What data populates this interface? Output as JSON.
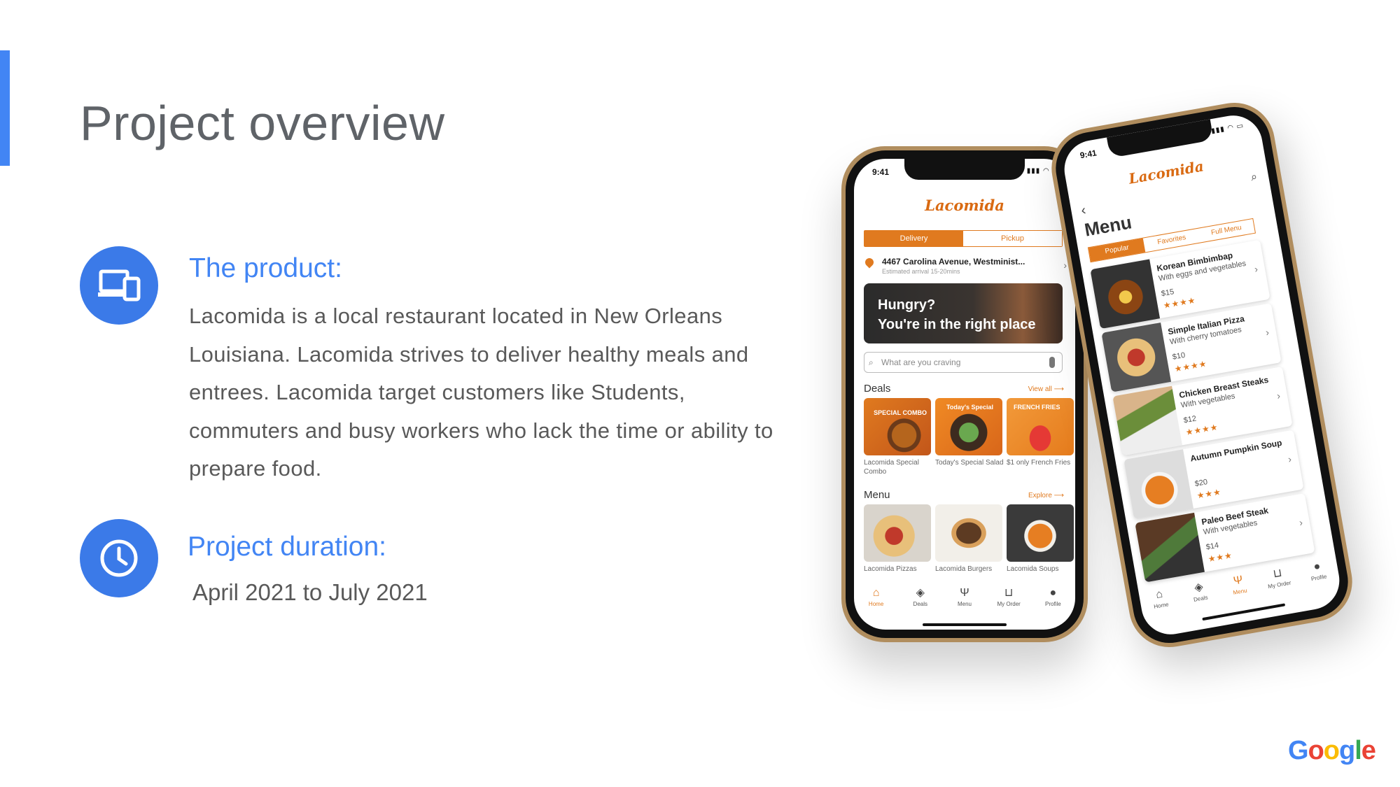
{
  "slide": {
    "title": "Project overview",
    "product_heading": "The product:",
    "product_description": "Lacomida is a local restaurant located in New Orleans Louisiana. Lacomida strives to deliver healthy meals and entrees. Lacomida target customers like Students, commuters and busy workers who lack the time or ability to prepare food.",
    "duration_heading": "Project duration:",
    "duration_value": "April 2021 to July 2021",
    "footer_logo": [
      "G",
      "o",
      "o",
      "g",
      "l",
      "e"
    ],
    "footer_logo_colors": [
      "#4285f4",
      "#ea4335",
      "#fbbc05",
      "#4285f4",
      "#34a853",
      "#ea4335"
    ],
    "accent_color": "#4285f4",
    "icons": {
      "product": "devices-icon",
      "duration": "clock-icon"
    }
  },
  "phone_home": {
    "time": "9:41",
    "logo": "Lacomida",
    "segments": [
      "Delivery",
      "Pickup"
    ],
    "address": "4467 Carolina Avenue, Westminist...",
    "arrival": "Estimated arrival 15-20mins",
    "hero_line1": "Hungry?",
    "hero_line2": "You're in the right place",
    "search_placeholder": "What are you craving",
    "deals_label": "Deals",
    "deals_link": "View all ⟶",
    "deals": [
      {
        "caption": "Lacomida  Special Combo",
        "badge": "SPECIAL COMBO"
      },
      {
        "caption": "Today's  Special Salad",
        "badge": "Today's Special"
      },
      {
        "caption": "$1 only French Fries",
        "badge": "FRENCH FRIES"
      }
    ],
    "menu_label": "Menu",
    "menu_link": "Explore ⟶",
    "menu": [
      {
        "caption": "Lacomida Pizzas"
      },
      {
        "caption": "Lacomida Burgers"
      },
      {
        "caption": "Lacomida Soups"
      }
    ],
    "tabs": [
      "Home",
      "Deals",
      "Menu",
      "My Order",
      "Profile"
    ]
  },
  "phone_menu": {
    "time": "9:41",
    "logo": "Lacomida",
    "title": "Menu",
    "segments": [
      "Popular",
      "Favorites",
      "Full Menu"
    ],
    "items": [
      {
        "name": "Korean Bimbimbap",
        "sub": "With eggs and vegetables",
        "price": "$15",
        "stars": "★★★★"
      },
      {
        "name": "Simple Italian Pizza",
        "sub": "With cherry tomatoes",
        "price": "$10",
        "stars": "★★★★"
      },
      {
        "name": "Chicken Breast Steaks",
        "sub": "With vegetables",
        "price": "$12",
        "stars": "★★★★"
      },
      {
        "name": "Autumn Pumpkin Soup",
        "sub": "",
        "price": "$20",
        "stars": "★★★"
      },
      {
        "name": "Paleo Beef Steak",
        "sub": "With vegetables",
        "price": "$14",
        "stars": "★★★"
      }
    ],
    "tabs": [
      "Home",
      "Deals",
      "Menu",
      "My Order",
      "Profile"
    ]
  }
}
